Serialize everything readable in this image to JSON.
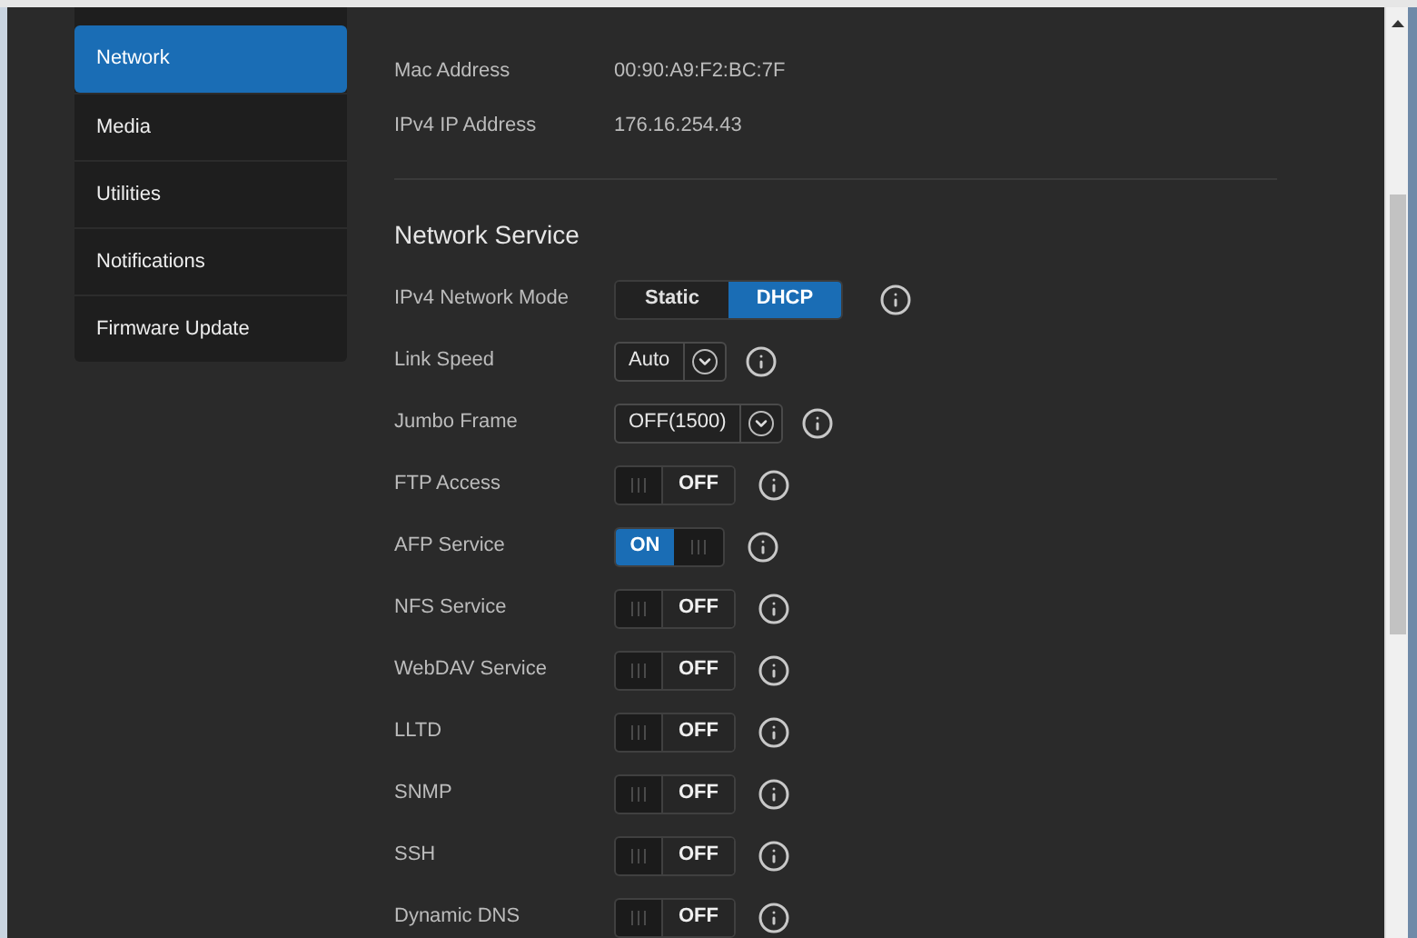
{
  "sidebar": {
    "items": [
      {
        "label": "Network",
        "selected": true
      },
      {
        "label": "Media",
        "selected": false
      },
      {
        "label": "Utilities",
        "selected": false
      },
      {
        "label": "Notifications",
        "selected": false
      },
      {
        "label": "Firmware Update",
        "selected": false
      }
    ]
  },
  "info": [
    {
      "label": "Mac Address",
      "value": "00:90:A9:F2:BC:7F"
    },
    {
      "label": "IPv4 IP Address",
      "value": "176.16.254.43"
    }
  ],
  "section_title": "Network Service",
  "settings": [
    {
      "label": "IPv4 Network Mode",
      "kind": "segmented",
      "options": [
        {
          "label": "Static",
          "selected": false
        },
        {
          "label": "DHCP",
          "selected": true
        }
      ]
    },
    {
      "label": "Link Speed",
      "kind": "dropdown",
      "value": "Auto"
    },
    {
      "label": "Jumbo Frame",
      "kind": "dropdown",
      "value": "OFF(1500)"
    },
    {
      "label": "FTP Access",
      "kind": "toggle",
      "on": false,
      "state_text": "OFF"
    },
    {
      "label": "AFP Service",
      "kind": "toggle",
      "on": true,
      "state_text": "ON"
    },
    {
      "label": "NFS Service",
      "kind": "toggle",
      "on": false,
      "state_text": "OFF"
    },
    {
      "label": "WebDAV Service",
      "kind": "toggle",
      "on": false,
      "state_text": "OFF"
    },
    {
      "label": "LLTD",
      "kind": "toggle",
      "on": false,
      "state_text": "OFF"
    },
    {
      "label": "SNMP",
      "kind": "toggle",
      "on": false,
      "state_text": "OFF"
    },
    {
      "label": "SSH",
      "kind": "toggle",
      "on": false,
      "state_text": "OFF"
    },
    {
      "label": "Dynamic DNS",
      "kind": "toggle",
      "on": false,
      "state_text": "OFF"
    }
  ]
}
